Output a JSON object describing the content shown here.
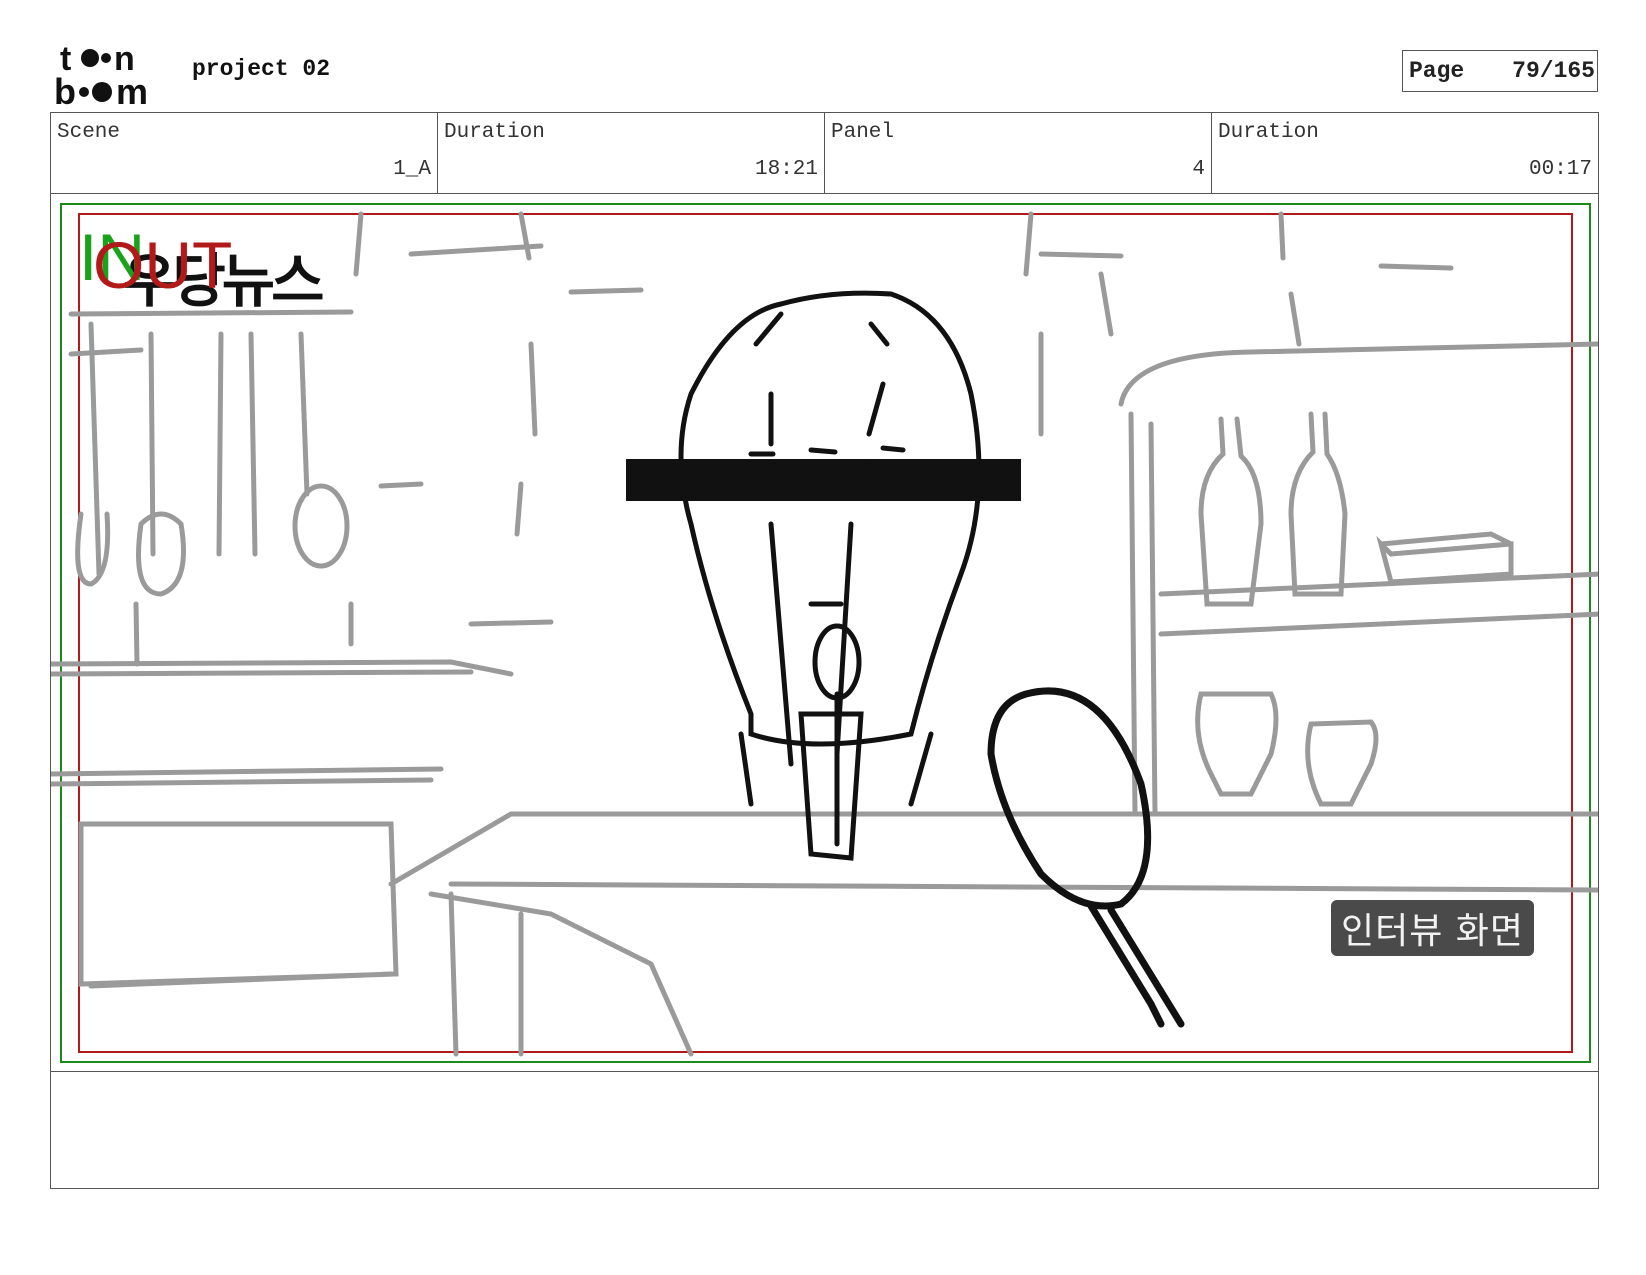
{
  "header": {
    "project_title": "project 02",
    "page_label": "Page",
    "page_number": "79/165"
  },
  "info": {
    "scene_label": "Scene",
    "scene_value": "1_A",
    "scene_duration_label": "Duration",
    "scene_duration_value": "18:21",
    "panel_label": "Panel",
    "panel_value": "4",
    "panel_duration_label": "Duration",
    "panel_duration_value": "00:17"
  },
  "panel": {
    "in_marker": "IN",
    "out_marker": "OUT",
    "title_sketch": "우당뉴스",
    "caption_badge": "인터뷰 화면",
    "safe_area_color": "#1a8a1a",
    "action_area_color": "#b21a1a"
  },
  "notes": {
    "text": ""
  }
}
